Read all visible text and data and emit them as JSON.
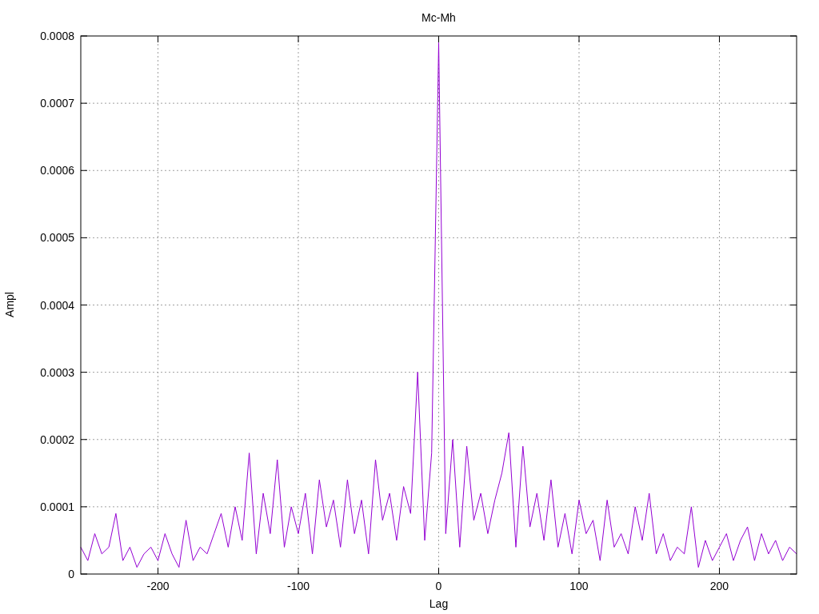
{
  "chart_data": {
    "type": "line",
    "title": "Mc-Mh",
    "xlabel": "Lag",
    "ylabel": "Ampl",
    "xlim": [
      -255,
      255
    ],
    "grid": true,
    "ylim": [
      0,
      0.0008
    ],
    "xticks": [
      -200,
      -100,
      0,
      100,
      200
    ],
    "yticks": [
      0,
      0.0001,
      0.0002,
      0.0003,
      0.0004,
      0.0005,
      0.0006,
      0.0007,
      0.0008
    ],
    "x": [
      -255,
      -250,
      -245,
      -240,
      -235,
      -230,
      -225,
      -220,
      -215,
      -210,
      -205,
      -200,
      -195,
      -190,
      -185,
      -180,
      -175,
      -170,
      -165,
      -160,
      -155,
      -150,
      -145,
      -140,
      -135,
      -130,
      -125,
      -120,
      -115,
      -110,
      -105,
      -100,
      -95,
      -90,
      -85,
      -80,
      -75,
      -70,
      -65,
      -60,
      -55,
      -50,
      -45,
      -40,
      -35,
      -30,
      -25,
      -20,
      -15,
      -10,
      -5,
      0,
      5,
      10,
      15,
      20,
      25,
      30,
      35,
      40,
      45,
      50,
      55,
      60,
      65,
      70,
      75,
      80,
      85,
      90,
      95,
      100,
      105,
      110,
      115,
      120,
      125,
      130,
      135,
      140,
      145,
      150,
      155,
      160,
      165,
      170,
      175,
      180,
      185,
      190,
      195,
      200,
      205,
      210,
      215,
      220,
      225,
      230,
      235,
      240,
      245,
      250,
      255
    ],
    "series": [
      {
        "color": "#9400d3",
        "values": [
          4e-05,
          2e-05,
          6e-05,
          3e-05,
          4e-05,
          9e-05,
          2e-05,
          4e-05,
          1e-05,
          3e-05,
          4e-05,
          2e-05,
          6e-05,
          3e-05,
          1e-05,
          8e-05,
          2e-05,
          4e-05,
          3e-05,
          6e-05,
          9e-05,
          4e-05,
          0.0001,
          5e-05,
          0.00018,
          3e-05,
          0.00012,
          6e-05,
          0.00017,
          4e-05,
          0.0001,
          6e-05,
          0.00012,
          3e-05,
          0.00014,
          7e-05,
          0.00011,
          4e-05,
          0.00014,
          6e-05,
          0.00011,
          3e-05,
          0.00017,
          8e-05,
          0.00012,
          5e-05,
          0.00013,
          9e-05,
          0.0003,
          5e-05,
          0.00018,
          0.00079,
          6e-05,
          0.0002,
          4e-05,
          0.00019,
          8e-05,
          0.00012,
          6e-05,
          0.00011,
          0.00015,
          0.00021,
          4e-05,
          0.00019,
          7e-05,
          0.00012,
          5e-05,
          0.00014,
          4e-05,
          9e-05,
          3e-05,
          0.00011,
          6e-05,
          8e-05,
          2e-05,
          0.00011,
          4e-05,
          6e-05,
          3e-05,
          0.0001,
          5e-05,
          0.00012,
          3e-05,
          6e-05,
          2e-05,
          4e-05,
          3e-05,
          0.0001,
          1e-05,
          5e-05,
          2e-05,
          4e-05,
          6e-05,
          2e-05,
          5e-05,
          7e-05,
          2e-05,
          6e-05,
          3e-05,
          5e-05,
          2e-05,
          4e-05,
          3e-05
        ]
      }
    ]
  }
}
